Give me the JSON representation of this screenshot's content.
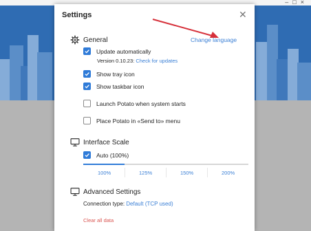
{
  "window": {
    "controls": [
      "–",
      "□",
      "×"
    ]
  },
  "dialog": {
    "title": "Settings",
    "close_icon": "close-icon",
    "change_language": "Change language",
    "general": {
      "title": "General",
      "icon": "gear-icon",
      "update_automatically": {
        "label": "Update automatically",
        "checked": true
      },
      "version_text": "Version 0.10.23:",
      "check_updates": "Check for updates",
      "show_tray_icon": {
        "label": "Show tray icon",
        "checked": true
      },
      "show_taskbar_icon": {
        "label": "Show taskbar icon",
        "checked": true
      },
      "launch_on_start": {
        "label": "Launch Potato when system starts",
        "checked": false
      },
      "send_to_menu": {
        "label": "Place Potato in «Send to» menu",
        "checked": false
      }
    },
    "interface_scale": {
      "title": "Interface Scale",
      "icon": "monitor-icon",
      "auto": {
        "label": "Auto (100%)",
        "checked": true
      },
      "options": [
        "100%",
        "125%",
        "150%",
        "200%"
      ],
      "level_fraction": 0.25
    },
    "advanced": {
      "title": "Advanced Settings",
      "icon": "monitor-icon",
      "connection_label": "Connection type:",
      "connection_value": "Default (TCP used)",
      "clear_all_data": "Clear all data"
    }
  },
  "colors": {
    "accent": "#2f7bd8",
    "link": "#3a7fd5",
    "danger": "#d9534f",
    "annotation_arrow": "#d6303a"
  }
}
